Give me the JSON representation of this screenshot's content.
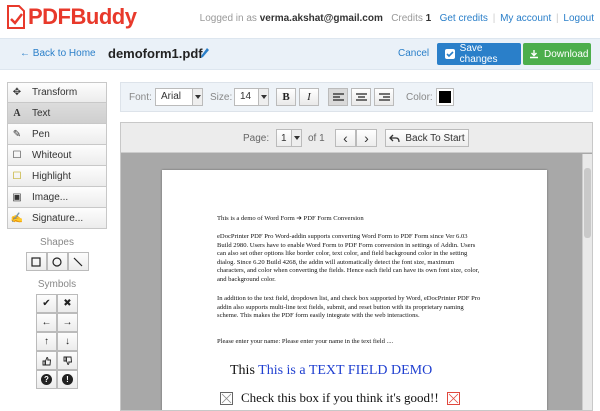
{
  "app": {
    "logo_pdf": "PDF",
    "logo_buddy": "Buddy",
    "logged_in_label": "Logged in as",
    "email": "verma.akshat@gmail.com",
    "credits_label": "Credits",
    "credits_value": "1",
    "get_credits": "Get credits",
    "my_account": "My account",
    "logout": "Logout",
    "sep": "|"
  },
  "docbar": {
    "back": "← Back to Home",
    "filename": "demoform1.pdf",
    "cancel": "Cancel",
    "save": "Save changes",
    "download": "Download"
  },
  "tools": [
    {
      "icon": "move-icon",
      "glyph": "✥",
      "label": "Transform"
    },
    {
      "icon": "text-icon",
      "glyph": "A",
      "label": "Text"
    },
    {
      "icon": "pen-icon",
      "glyph": "✎",
      "label": "Pen"
    },
    {
      "icon": "whiteout-icon",
      "glyph": "☐",
      "label": "Whiteout"
    },
    {
      "icon": "highlight-icon",
      "glyph": "☐",
      "label": "Highlight"
    },
    {
      "icon": "image-icon",
      "glyph": "▣",
      "label": "Image..."
    },
    {
      "icon": "signature-icon",
      "glyph": "✍",
      "label": "Signature..."
    }
  ],
  "shapes_label": "Shapes",
  "symbols_label": "Symbols",
  "symbols": [
    {
      "name": "check-icon",
      "glyph": "✔"
    },
    {
      "name": "cross-icon",
      "glyph": "✖"
    },
    {
      "name": "arrow-left-icon",
      "glyph": "←"
    },
    {
      "name": "arrow-right-icon",
      "glyph": "→"
    },
    {
      "name": "arrow-up-icon",
      "glyph": "↑"
    },
    {
      "name": "arrow-down-icon",
      "glyph": "↓"
    },
    {
      "name": "thumbs-up-icon",
      "glyph": "👍"
    },
    {
      "name": "thumbs-down-icon",
      "glyph": "👎"
    },
    {
      "name": "question-icon",
      "glyph": "?"
    },
    {
      "name": "exclamation-icon",
      "glyph": "!"
    }
  ],
  "fontbar": {
    "font_label": "Font:",
    "font_value": "Arial",
    "size_label": "Size:",
    "size_value": "14",
    "bold": "B",
    "italic": "I",
    "color_label": "Color:",
    "color_value": "#000000"
  },
  "pager": {
    "page_label": "Page:",
    "page_value": "1",
    "of_label": "of 1",
    "prev": "‹",
    "next": "›",
    "back_to_start": "Back To Start"
  },
  "document": {
    "line1": "This is a demo of Word Form ➔ PDF Form Conversion",
    "para1": "eDocPrinter PDF Pro Word-addin supports converting Word Form to PDF Form since Ver 6.03 Build 2980. Users have to enable Word Form to PDF Form conversion in settings of Addin. Users can also set other options like border color, text color, and field background color in the setting dialog. Since 6.20 Build 4268, the addin will automatically detect the font size, maximum characters, and color when converting the fields. Hence each field can have its own font size, color, and background color.",
    "para2": "In addition to the text field, dropdown list, and check box supported by Word, eDocPrinter PDF Pro addin also supports multi-line text fields, submit, and reset button with its proprietary naming scheme. This makes the PDF form easily integrate with the web interactions.",
    "line_name": "Please enter your name:   Please enter your name in the text field ....",
    "big_this": "This ",
    "big_field": "This is a TEXT FIELD DEMO",
    "check_text": "Check this box if you think it's good!!"
  }
}
